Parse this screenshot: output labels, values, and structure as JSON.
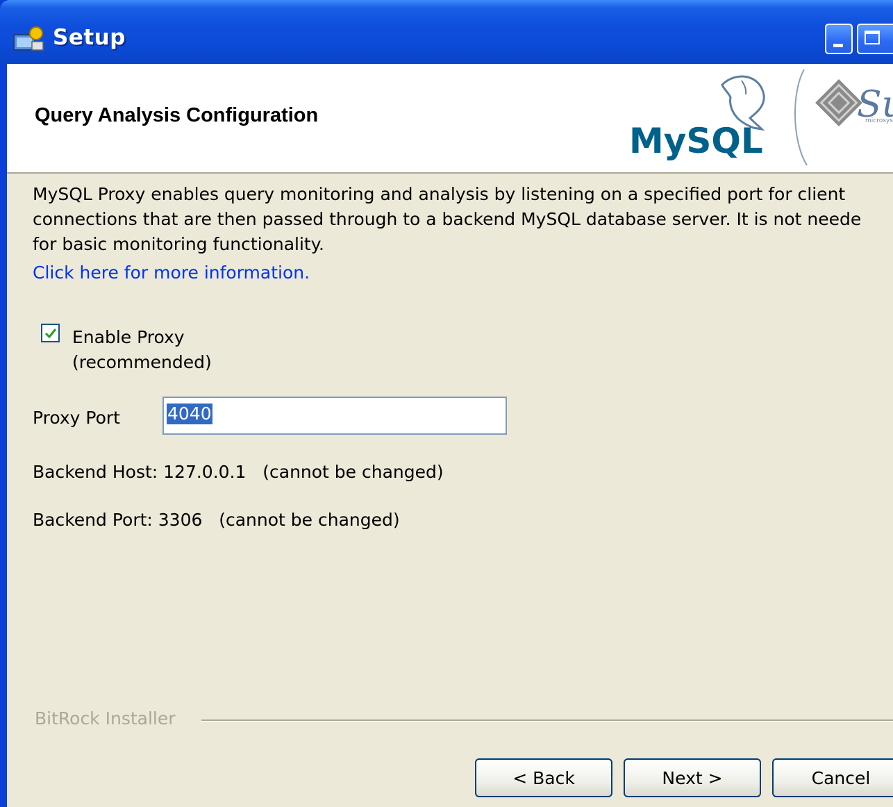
{
  "window": {
    "title": "Setup"
  },
  "header": {
    "title": "Query Analysis Configuration",
    "logo_mysql": "MySQL",
    "logo_sun": "Sun",
    "logo_sun_sub": "microsystems"
  },
  "body": {
    "description": "MySQL Proxy enables query monitoring and analysis by listening on a specified port for client\nconnections that are then passed through to a backend MySQL database server. It is not neede\nfor basic monitoring functionality.",
    "link_text": "Click here for more information.",
    "checkbox": {
      "label": "Enable Proxy",
      "sublabel": "(recommended)",
      "checked": true
    },
    "proxy_port_label": "Proxy Port",
    "proxy_port_value": "4040",
    "backend_host": "Backend Host: 127.0.0.1   (cannot be changed)",
    "backend_port": "Backend Port: 3306   (cannot be changed)"
  },
  "footer": {
    "brand": "BitRock Installer",
    "back_label": "< Back",
    "next_label": "Next >",
    "cancel_label": "Cancel"
  }
}
